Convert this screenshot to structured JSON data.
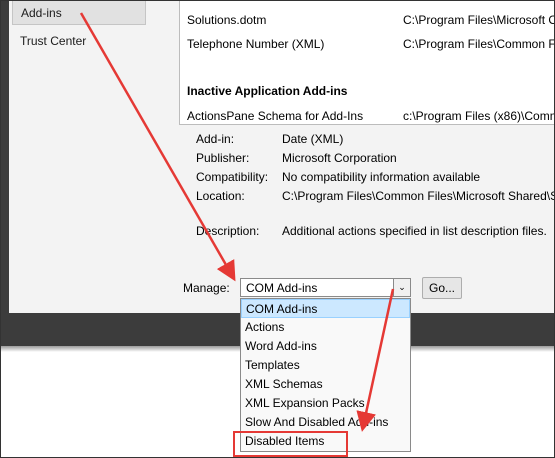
{
  "nav": {
    "items": [
      "Add-ins",
      "Trust Center"
    ]
  },
  "addin_list": {
    "rows": [
      {
        "name": "Solutions.dotm",
        "location": "C:\\Program Files\\Microsoft Of"
      },
      {
        "name": "Telephone Number (XML)",
        "location": "C:\\Program Files\\Common Fi"
      }
    ],
    "inactive_header": "Inactive Application Add-ins",
    "inactive_rows": [
      {
        "name": "ActionsPane Schema for Add-Ins",
        "location": "c:\\Program Files (x86)\\Comm"
      }
    ]
  },
  "details": {
    "addin_label": "Add-in:",
    "addin_value": "Date (XML)",
    "publisher_label": "Publisher:",
    "publisher_value": "Microsoft Corporation",
    "compat_label": "Compatibility:",
    "compat_value": "No compatibility information available",
    "location_label": "Location:",
    "location_value": "C:\\Program Files\\Common Files\\Microsoft Shared\\S",
    "description_label": "Description:",
    "description_value": "Additional actions specified in list description files."
  },
  "manage": {
    "label": "Manage:",
    "selected": "COM Add-ins",
    "go_label": "Go...",
    "options": [
      "COM Add-ins",
      "Actions",
      "Word Add-ins",
      "Templates",
      "XML Schemas",
      "XML Expansion Packs",
      "Slow And Disabled Add-ins",
      "Disabled Items"
    ],
    "highlighted_index": 0,
    "callout_index": 7
  },
  "colors": {
    "annotation": "#e53935",
    "highlight": "#cce8ff"
  }
}
